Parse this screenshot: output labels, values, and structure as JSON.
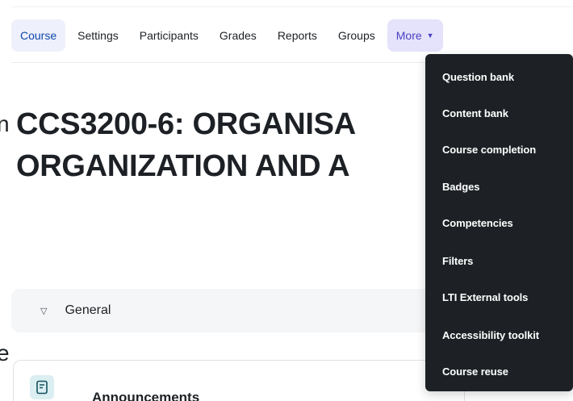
{
  "nav": {
    "tabs": [
      {
        "label": "Course",
        "active": true
      },
      {
        "label": "Settings"
      },
      {
        "label": "Participants"
      },
      {
        "label": "Grades"
      },
      {
        "label": "Reports"
      },
      {
        "label": "Groups"
      }
    ],
    "more_label": "More",
    "more_icon": "caret-down-icon"
  },
  "partial_left": {
    "top": "n",
    "bottom": "e"
  },
  "course": {
    "title_line1": "CCS3200-6: ORGANISA",
    "title_line2": "ORGANIZATION AND A"
  },
  "section": {
    "name": "General",
    "collapse_icon": "triangle-down-icon"
  },
  "activity": {
    "name": "Announcements",
    "icon": "forum-icon"
  },
  "more_menu": {
    "items": [
      "Question bank",
      "Content bank",
      "Course completion",
      "Badges",
      "Competencies",
      "Filters",
      "LTI External tools",
      "Accessibility toolkit",
      "Course reuse"
    ]
  },
  "colors": {
    "active_tab_text": "#0f47ad",
    "more_tab_bg": "#e5e3fb",
    "dropdown_bg": "#1d2125"
  }
}
